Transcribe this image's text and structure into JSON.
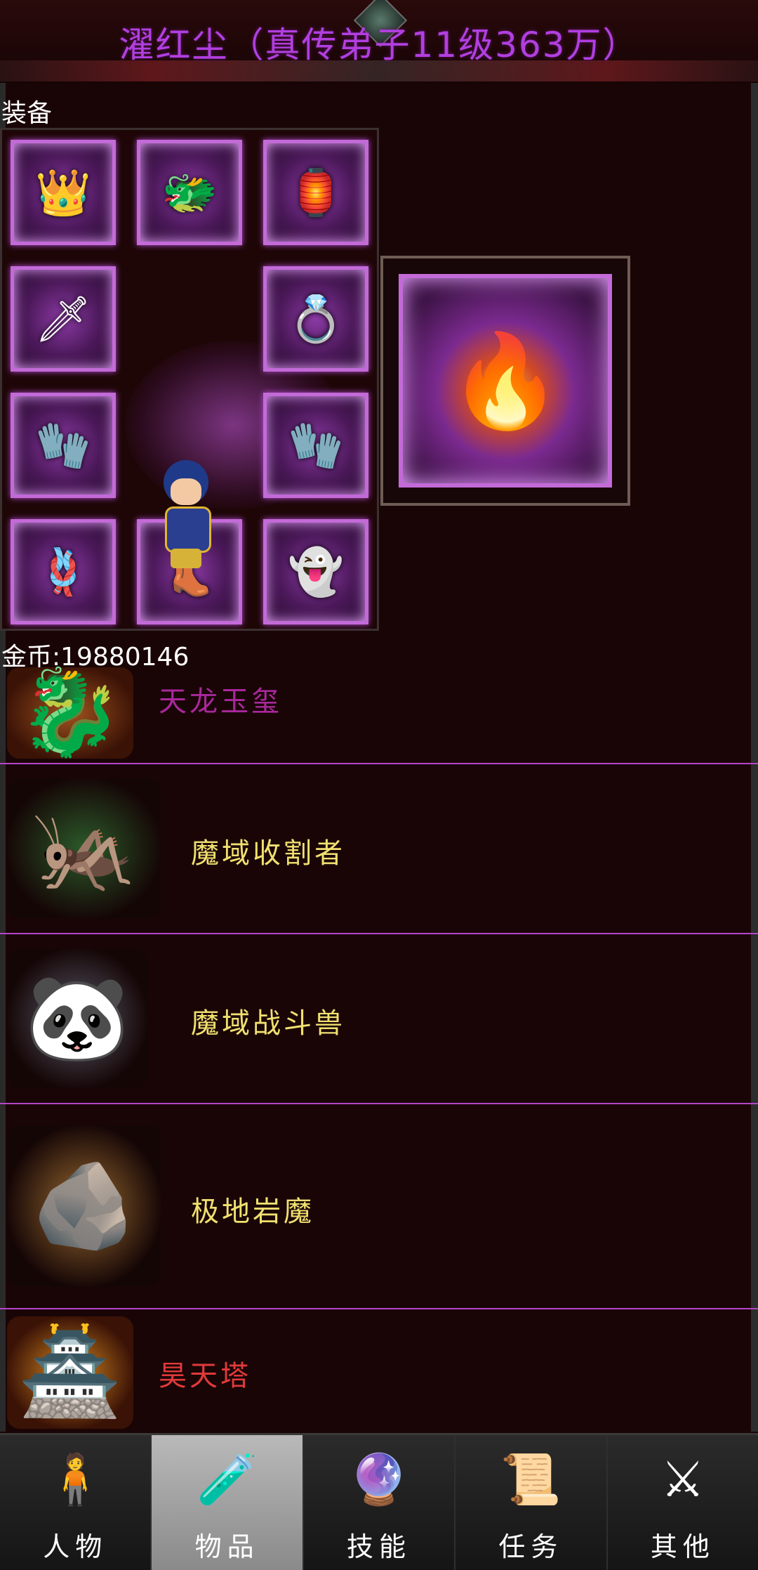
{
  "header": {
    "title": "濯红尘（真传弟子11级363万）"
  },
  "equipment": {
    "label": "装备",
    "slots": [
      {
        "icon": "crown-armor-icon",
        "glyph": "👑"
      },
      {
        "icon": "dragon-helmet-icon",
        "glyph": "🐲"
      },
      {
        "icon": "lantern-amulet-icon",
        "glyph": "🏮"
      },
      {
        "icon": "golden-sword-icon",
        "glyph": "🗡"
      },
      {
        "icon": "red-ring-icon",
        "glyph": "💍"
      },
      {
        "icon": "bracer-left-icon",
        "glyph": "🧤"
      },
      {
        "icon": "bracer-right-icon",
        "glyph": "🧤"
      },
      {
        "icon": "belt-icon",
        "glyph": "🪢"
      },
      {
        "icon": "boots-icon",
        "glyph": "👢"
      },
      {
        "icon": "beast-spirit-icon",
        "glyph": "👻"
      }
    ],
    "featured": {
      "icon": "phoenix-mount-icon",
      "glyph": "🔥"
    },
    "gold_text": "金币:19880146"
  },
  "items": [
    {
      "name": "天龙玉玺",
      "icon": "jade-seal-icon",
      "glyph": "🐉",
      "color": "#a9289c"
    },
    {
      "name": "魔域收割者",
      "icon": "reaper-beetle-icon",
      "glyph": "🦗",
      "color": "#f0e070"
    },
    {
      "name": "魔域战斗兽",
      "icon": "battle-beast-icon",
      "glyph": "🐼",
      "color": "#f0e070"
    },
    {
      "name": "极地岩魔",
      "icon": "rock-golem-icon",
      "glyph": "🪨",
      "color": "#f0e070"
    },
    {
      "name": "昊天塔",
      "icon": "heaven-tower-icon",
      "glyph": "🏯",
      "color": "#e03a3a"
    }
  ],
  "nav": [
    {
      "label": "人物",
      "icon": "character-icon",
      "glyph": "🧍",
      "active": false
    },
    {
      "label": "物品",
      "icon": "potion-icon",
      "glyph": "🧪",
      "active": true
    },
    {
      "label": "技能",
      "icon": "skill-orb-icon",
      "glyph": "🔮",
      "active": false
    },
    {
      "label": "任务",
      "icon": "quest-scroll-icon",
      "glyph": "📜",
      "active": false
    },
    {
      "label": "其他",
      "icon": "misc-sword-icon",
      "glyph": "⚔",
      "active": false
    }
  ]
}
